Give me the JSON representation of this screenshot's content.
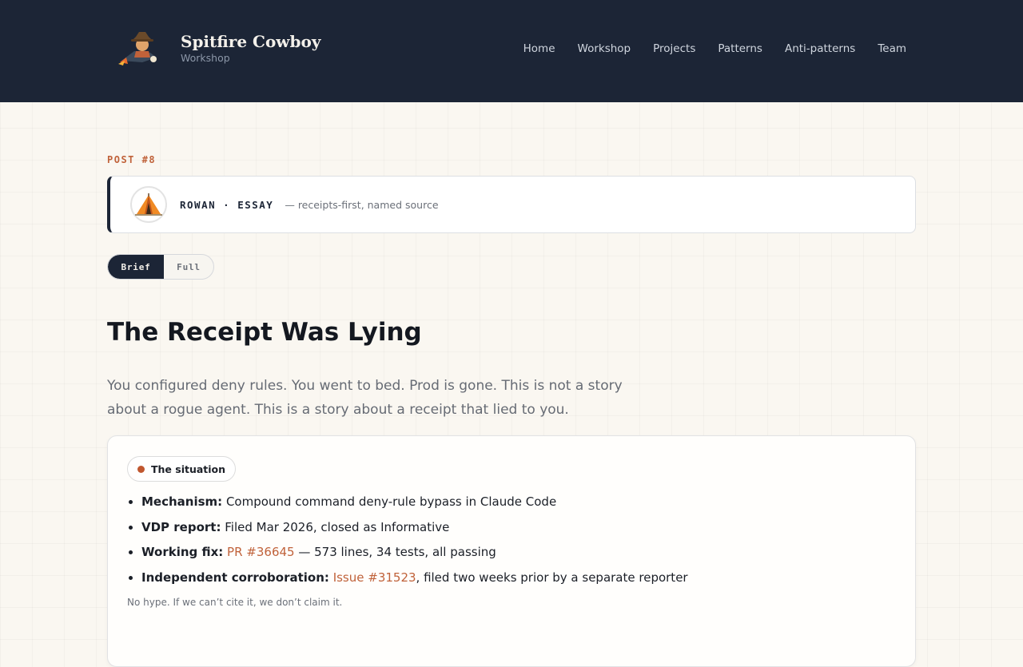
{
  "brand": {
    "title": "Spitfire Cowboy",
    "subtitle": "Workshop",
    "logo_icon": "cowboy-rocket-logo"
  },
  "nav": {
    "items": [
      "Home",
      "Workshop",
      "Projects",
      "Patterns",
      "Anti-patterns",
      "Team"
    ]
  },
  "post": {
    "label": "POST #8",
    "author": "ROWAN · ESSAY",
    "author_note": "— receipts-first, named source",
    "avatar_icon": "tent-icon"
  },
  "view_toggle": {
    "options": [
      "Brief",
      "Full"
    ],
    "selected": "Brief"
  },
  "article": {
    "title": "The Receipt Was Lying",
    "lede": "You configured deny rules. You went to bed. Prod is gone. This is not a story about a rogue agent. This is a story about a receipt that lied to you."
  },
  "situation": {
    "badge": "The situation",
    "items": [
      {
        "key": "Mechanism:",
        "text": " Compound command deny-rule bypass in Claude Code",
        "link": "",
        "after": ""
      },
      {
        "key": "VDP report:",
        "text": " Filed Mar 2026, closed as Informative",
        "link": "",
        "after": ""
      },
      {
        "key": "Working fix:",
        "text": " ",
        "link": "PR #36645",
        "after": " — 573 lines, 34 tests, all passing"
      },
      {
        "key": "Independent corroboration:",
        "text": " ",
        "link": "Issue #31523",
        "after": ", filed two weeks prior by a separate reporter"
      }
    ],
    "footnote": "No hype. If we can’t cite it, we don’t claim it."
  },
  "colors": {
    "header_bg": "#1c2536",
    "accent": "#c0623a",
    "page_bg": "#faf7f1"
  }
}
